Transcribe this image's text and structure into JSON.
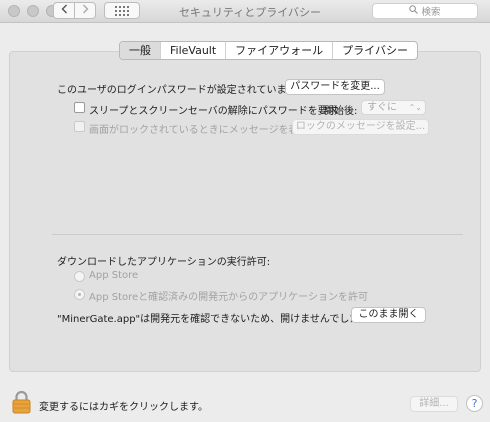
{
  "window": {
    "title": "セキュリティとプライバシー",
    "search_placeholder": "検索",
    "back_icon": "chevron-left-icon",
    "forward_icon": "chevron-right-icon",
    "grid_icon": "grid-icon"
  },
  "tabs": [
    {
      "label": "一般",
      "selected": true
    },
    {
      "label": "FileVault",
      "selected": false
    },
    {
      "label": "ファイアウォール",
      "selected": false
    },
    {
      "label": "プライバシー",
      "selected": false
    }
  ],
  "general": {
    "password_label": "このユーザのログインパスワードが設定されています",
    "change_password_button": "パスワードを変更...",
    "require_password_label": "スリープとスクリーンセーバの解除にパスワードを要求",
    "require_password_checked": false,
    "after_label": "開始後:",
    "after_value": "すぐに",
    "lock_message_label": "画面がロックされているときにメッセージを表示",
    "lock_message_checked": false,
    "lock_message_button": "ロックのメッセージを設定..."
  },
  "downloads": {
    "heading": "ダウンロードしたアプリケーションの実行許可:",
    "option_app_store": "App Store",
    "option_identified": "App Storeと確認済みの開発元からのアプリケーションを許可",
    "selected_option": "option_identified",
    "blocked_message": "\"MinerGate.app\"は開発元を確認できないため、開けませんでした。",
    "open_anyway_button": "このまま開く"
  },
  "footer": {
    "lock_text": "変更するにはカギをクリックします。",
    "lock_icon": "lock-icon",
    "advanced_button": "詳細...",
    "help_label": "?"
  }
}
